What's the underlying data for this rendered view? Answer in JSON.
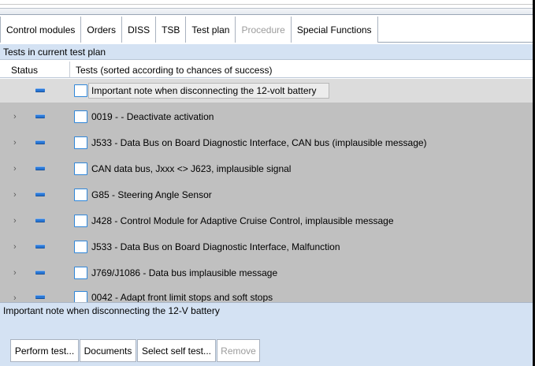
{
  "tabs": [
    {
      "label": "Control modules",
      "state": "normal"
    },
    {
      "label": "Orders",
      "state": "normal"
    },
    {
      "label": "DISS",
      "state": "normal"
    },
    {
      "label": "TSB",
      "state": "normal"
    },
    {
      "label": "Test plan",
      "state": "active"
    },
    {
      "label": "Procedure",
      "state": "disabled"
    },
    {
      "label": "Special Functions",
      "state": "normal"
    }
  ],
  "section": {
    "title": "Tests in current test plan"
  },
  "columns": {
    "status": "Status",
    "tests": "Tests (sorted according to chances of success)"
  },
  "rows": [
    {
      "label": "Important note when disconnecting the 12-volt battery",
      "expandable": false
    },
    {
      "label": "0019 - - Deactivate activation",
      "expandable": true
    },
    {
      "label": "J533 - Data Bus on Board Diagnostic Interface, CAN bus (implausible message)",
      "expandable": true
    },
    {
      "label": "CAN data bus, Jxxx <> J623, implausible signal",
      "expandable": true
    },
    {
      "label": "G85 - Steering Angle Sensor",
      "expandable": true
    },
    {
      "label": "J428 - Control Module for Adaptive Cruise Control, implausible message",
      "expandable": true
    },
    {
      "label": "J533 - Data Bus on Board Diagnostic Interface, Malfunction",
      "expandable": true
    },
    {
      "label": "J769/J1086 -  Data bus implausible message",
      "expandable": true
    },
    {
      "label": "0042 - Adapt front limit stops and soft stops",
      "expandable": true
    }
  ],
  "description": {
    "text": "Important note when disconnecting the 12-V battery"
  },
  "buttons": {
    "perform": "Perform test...",
    "documents": "Documents",
    "select_self_test": "Select self test...",
    "remove": "Remove"
  },
  "icons": {
    "expand": "chevron-right-icon",
    "status": "status-indicator-icon",
    "document": "document-icon"
  },
  "colors": {
    "accent": "#2a78d6",
    "panel": "#d4e2f3",
    "list_bg": "#c0c0c0",
    "disabled_text": "#9c9c9c"
  }
}
